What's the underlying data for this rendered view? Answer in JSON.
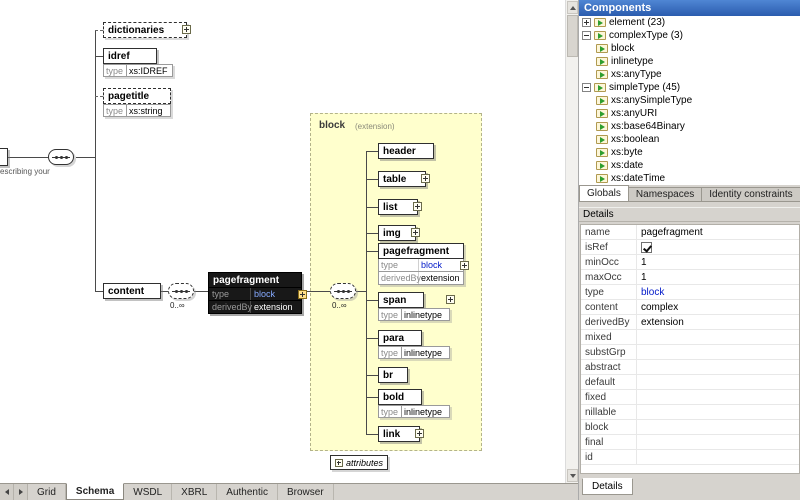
{
  "diagram": {
    "annotation": "escribing your",
    "occurs": "0..∞",
    "dictionaries": {
      "label": "dictionaries"
    },
    "idref": {
      "label": "idref",
      "type_key": "type",
      "type_value": "xs:IDREF"
    },
    "pagetitle": {
      "label": "pagetitle",
      "type_key": "type",
      "type_value": "xs:string"
    },
    "content": {
      "label": "content"
    },
    "pagefragment": {
      "label": "pagefragment",
      "type_key": "type",
      "type_value": "block",
      "derived_key": "derivedBy",
      "derived_value": "extension"
    },
    "block": {
      "title": "block",
      "suffix": "(extension)"
    },
    "children": [
      {
        "label": "header"
      },
      {
        "label": "table"
      },
      {
        "label": "list"
      },
      {
        "label": "img"
      },
      {
        "label": "pagefragment",
        "type_key": "type",
        "type_value": "block",
        "derived_key": "derivedBy",
        "derived_value": "extension"
      },
      {
        "label": "span",
        "type_key": "type",
        "type_value": "inlinetype"
      },
      {
        "label": "para",
        "type_key": "type",
        "type_value": "inlinetype"
      },
      {
        "label": "br"
      },
      {
        "label": "bold",
        "type_key": "type",
        "type_value": "inlinetype"
      },
      {
        "label": "link"
      }
    ],
    "attributes_label": "attributes"
  },
  "components": {
    "title": "Components",
    "tree": [
      {
        "label": "element (23)"
      },
      {
        "label": "complexType (3)"
      },
      {
        "label": "block"
      },
      {
        "label": "inlinetype"
      },
      {
        "label": "xs:anyType"
      },
      {
        "label": "simpleType (45)"
      },
      {
        "label": "xs:anySimpleType"
      },
      {
        "label": "xs:anyURI"
      },
      {
        "label": "xs:base64Binary"
      },
      {
        "label": "xs:boolean"
      },
      {
        "label": "xs:byte"
      },
      {
        "label": "xs:date"
      },
      {
        "label": "xs:dateTime"
      }
    ],
    "tabs": [
      {
        "label": "Globals"
      },
      {
        "label": "Namespaces"
      },
      {
        "label": "Identity constraints"
      }
    ],
    "active_tab": "Globals"
  },
  "details": {
    "header": "Details",
    "tab_label": "Details",
    "rows": [
      {
        "name": "name",
        "value": "pagefragment"
      },
      {
        "name": "isRef",
        "value": "",
        "checked": true
      },
      {
        "name": "minOcc",
        "value": "1"
      },
      {
        "name": "maxOcc",
        "value": "1"
      },
      {
        "name": "type",
        "value": "block"
      },
      {
        "name": "content",
        "value": "complex"
      },
      {
        "name": "derivedBy",
        "value": "extension"
      },
      {
        "name": "mixed",
        "value": ""
      },
      {
        "name": "substGrp",
        "value": ""
      },
      {
        "name": "abstract",
        "value": ""
      },
      {
        "name": "default",
        "value": ""
      },
      {
        "name": "fixed",
        "value": ""
      },
      {
        "name": "nillable",
        "value": ""
      },
      {
        "name": "block",
        "value": ""
      },
      {
        "name": "final",
        "value": ""
      },
      {
        "name": "id",
        "value": ""
      }
    ]
  },
  "bottom_tabs": [
    {
      "label": "Grid"
    },
    {
      "label": "Schema"
    },
    {
      "label": "WSDL"
    },
    {
      "label": "XBRL"
    },
    {
      "label": "Authentic"
    },
    {
      "label": "Browser"
    }
  ],
  "active_bottom_tab": "Schema"
}
